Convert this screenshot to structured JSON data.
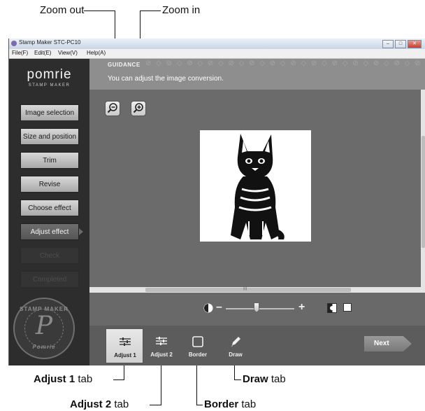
{
  "callouts": {
    "zoom_out": "Zoom out",
    "zoom_in": "Zoom in",
    "adjust1_bold": "Adjust 1",
    "adjust1_rest": " tab",
    "adjust2_bold": "Adjust 2",
    "adjust2_rest": " tab",
    "border_bold": "Border",
    "border_rest": " tab",
    "draw_bold": "Draw",
    "draw_rest": " tab"
  },
  "window": {
    "title": "Stamp Maker STC-PC10",
    "menu": [
      "File(F)",
      "Edit(E)",
      "View(V)",
      "Help(A)"
    ]
  },
  "sidebar": {
    "logo": "pomrie",
    "logo_sub": "STAMP MAKER",
    "steps": [
      {
        "label": "Image selection",
        "state": "done"
      },
      {
        "label": "Size and position",
        "state": "done"
      },
      {
        "label": "Trim",
        "state": "done"
      },
      {
        "label": "Revise",
        "state": "done"
      },
      {
        "label": "Choose effect",
        "state": "done"
      },
      {
        "label": "Adjust effect",
        "state": "active"
      },
      {
        "label": "Check",
        "state": "todo"
      },
      {
        "label": "Completed",
        "state": "todo"
      }
    ],
    "seal_letter": "P",
    "seal_top": "STAMP MAKER",
    "seal_bottom": "Pomrie"
  },
  "guidance": {
    "label": "GUIDANCE",
    "text": "You can adjust the image conversion."
  },
  "adjust": {
    "minus": "–",
    "plus": "+",
    "slider_level": 0.45
  },
  "tabs": [
    {
      "label": "Adjust 1",
      "icon": "sliders-icon",
      "selected": true
    },
    {
      "label": "Adjust 2",
      "icon": "sliders-icon",
      "selected": false
    },
    {
      "label": "Border",
      "icon": "square-icon",
      "selected": false
    },
    {
      "label": "Draw",
      "icon": "pencil-icon",
      "selected": false
    }
  ],
  "next_button": "Next",
  "colors": {
    "sidebar": "#2d2d2d",
    "canvas": "#6b6b6b",
    "active_step": "#5f5f5f"
  }
}
